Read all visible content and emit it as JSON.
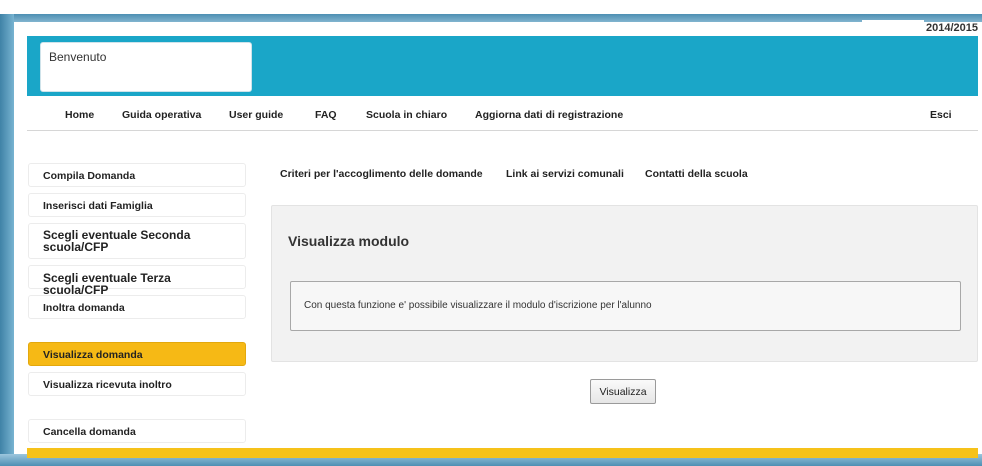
{
  "header": {
    "school_year": "2014/2015",
    "welcome": "Benvenuto"
  },
  "topnav": {
    "home": "Home",
    "guide": "Guida operativa",
    "user_guide": "User guide",
    "faq": "FAQ",
    "school_clear": "Scuola in chiaro",
    "update_registration": "Aggiorna dati di registrazione",
    "logout": "Esci"
  },
  "sidebar": {
    "items": [
      {
        "label": "Compila Domanda"
      },
      {
        "label": "Inserisci dati Famiglia"
      },
      {
        "label": "Scegli eventuale Seconda scuola/CFP"
      },
      {
        "label": "Scegli eventuale Terza scuola/CFP"
      },
      {
        "label": "Inoltra domanda"
      },
      {
        "label": "Visualizza domanda"
      },
      {
        "label": "Visualizza ricevuta inoltro"
      },
      {
        "label": "Cancella domanda"
      }
    ]
  },
  "subnav": {
    "criteria": "Criteri per l'accoglimento delle domande",
    "services": "Link ai servizi comunali",
    "contacts": "Contatti della scuola"
  },
  "panel": {
    "title": "Visualizza modulo",
    "message": "Con questa funzione e' possibile visualizzare il modulo d'iscrizione per l'alunno"
  },
  "actions": {
    "view_label": "Visualizza"
  },
  "colors": {
    "header": "#1aa6c8",
    "active": "#f6b915",
    "footer": "#f6c21a"
  }
}
